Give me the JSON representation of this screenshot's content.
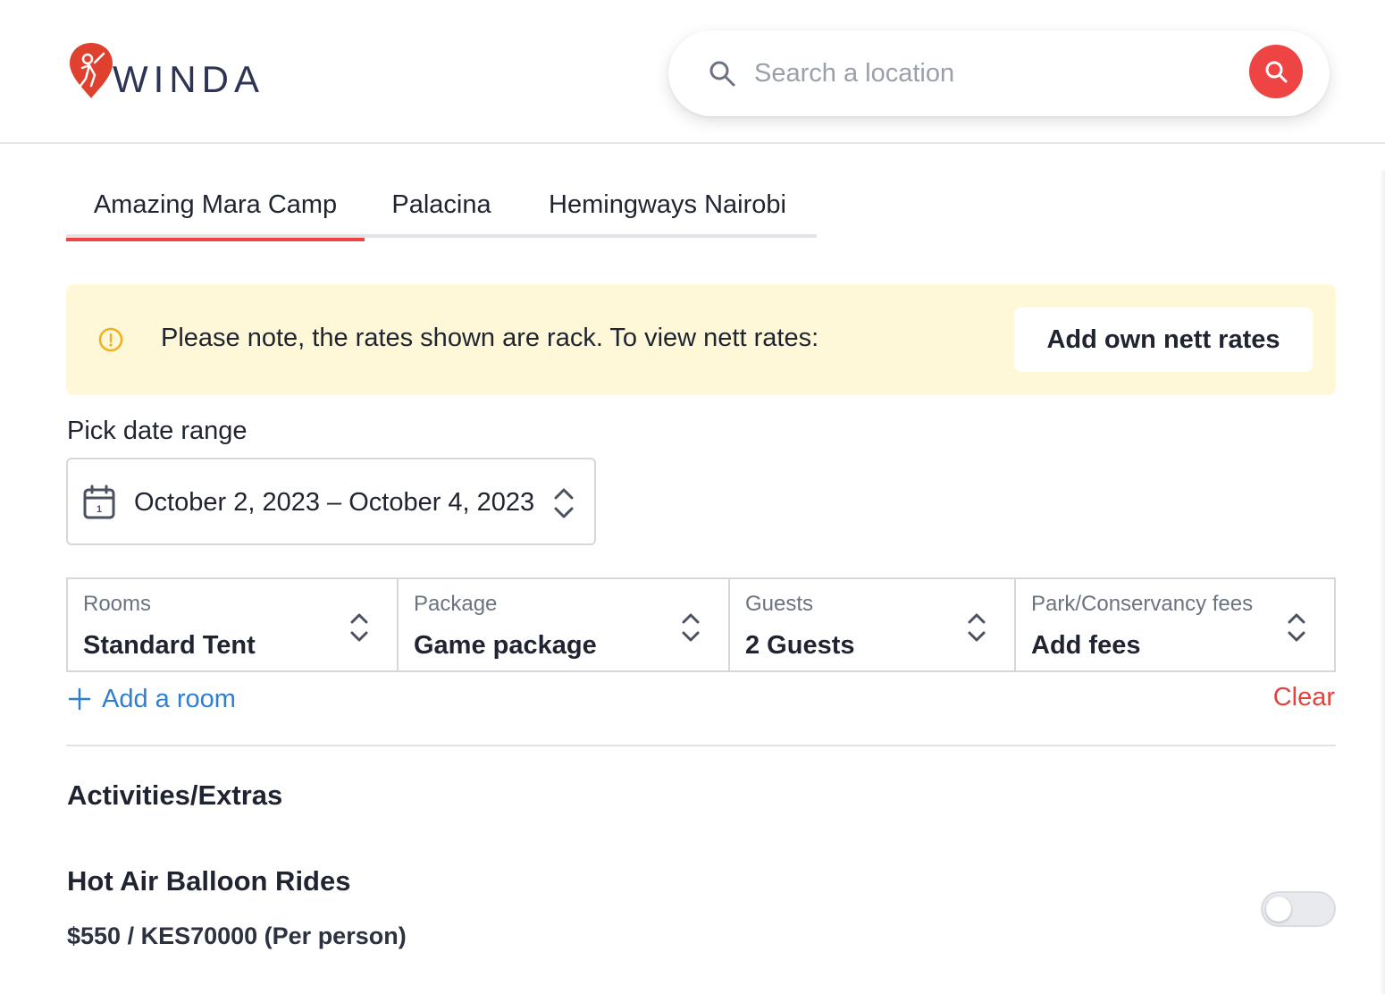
{
  "brand": {
    "name": "WINDA",
    "accent": "#ef4444"
  },
  "search": {
    "placeholder": "Search a location",
    "icon": "search-icon",
    "button_icon": "search-icon"
  },
  "tabs": [
    {
      "label": "Amazing Mara Camp",
      "active": true
    },
    {
      "label": "Palacina",
      "active": false
    },
    {
      "label": "Hemingways Nairobi",
      "active": false
    }
  ],
  "notice": {
    "icon": "alert-circle-icon",
    "text": "Please note, the rates shown are rack. To view nett rates:",
    "button_label": "Add own nett rates"
  },
  "date": {
    "label": "Pick date range",
    "value": "October 2, 2023 – October 4, 2023",
    "icon": "calendar-icon"
  },
  "selectors": [
    {
      "label": "Rooms",
      "value": "Standard Tent"
    },
    {
      "label": "Package",
      "value": "Game package"
    },
    {
      "label": "Guests",
      "value": "2 Guests"
    },
    {
      "label": "Park/Conservancy fees",
      "value": "Add fees"
    }
  ],
  "actions": {
    "add_room": "Add a room",
    "clear": "Clear"
  },
  "extras": {
    "title": "Activities/Extras",
    "items": [
      {
        "name": "Hot Air Balloon Rides",
        "price": "$550 / KES70000 (Per person)",
        "enabled": false
      }
    ]
  }
}
